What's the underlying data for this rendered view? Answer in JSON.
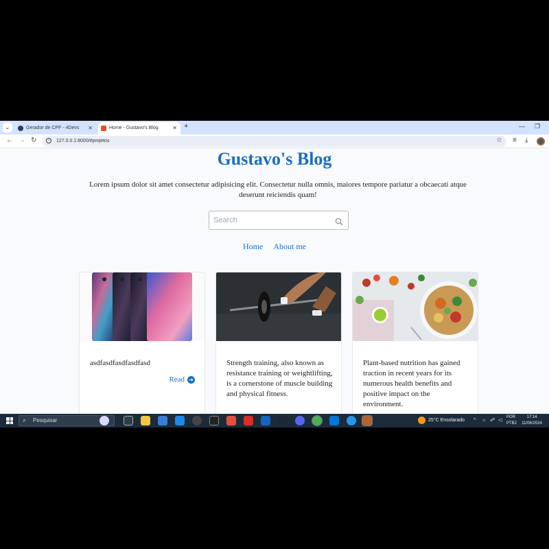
{
  "browser": {
    "tabs": [
      {
        "label": "Gerador de CPF - 4Devs",
        "active": false
      },
      {
        "label": "Home - Gustavo's Blog",
        "active": true
      }
    ],
    "address": "127.0.0.1:8000/#projetos"
  },
  "page": {
    "title": "Gustavo's Blog",
    "intro": "Lorem ipsum dolor sit amet consectetur adipisicing elit. Consectetur nulla omnis, maiores tempore pariatur a obcaecati atque deserunt reiciendis quam!",
    "search_placeholder": "Search",
    "nav": [
      {
        "label": "Home"
      },
      {
        "label": "About me"
      }
    ],
    "cards": [
      {
        "image": "smartphones",
        "text": "asdfasdfasdfasdfasd",
        "read_label": "Read"
      },
      {
        "image": "barbell-workout",
        "text": "Strength training, also known as resistance training or weightlifting, is a cornerstone of muscle building and physical fitness."
      },
      {
        "image": "salad-bowl",
        "text": "Plant-based nutrition has gained traction in recent years for its numerous health benefits and positive impact on the environment."
      }
    ]
  },
  "taskbar": {
    "search_label": "Pesquisar",
    "weather": "25°C  Ensolarado",
    "lang_top": "POR",
    "lang_bottom": "PTB2",
    "time": "17:14",
    "date": "11/06/2024"
  },
  "colors": {
    "accent": "#1b6ec2",
    "taskbar": "#1c2b3a",
    "tabbar": "#d3e3fd"
  }
}
